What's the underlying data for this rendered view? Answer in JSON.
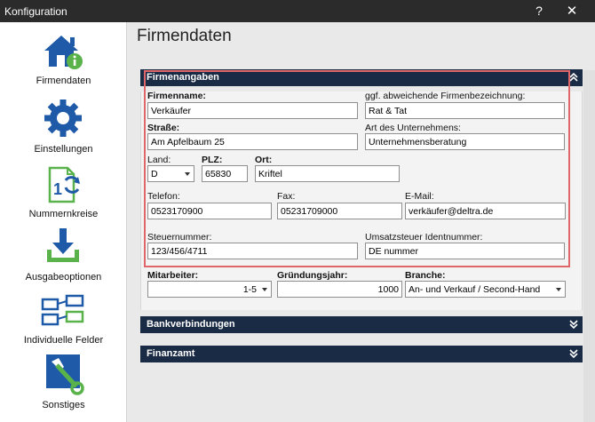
{
  "window": {
    "title": "Konfiguration",
    "help_label": "?",
    "close_label": "✕"
  },
  "sidebar": {
    "items": [
      {
        "label": "Firmendaten",
        "icon": "home-info-icon"
      },
      {
        "label": "Einstellungen",
        "icon": "gear-icon"
      },
      {
        "label": "Nummernkreise",
        "icon": "numbering-icon"
      },
      {
        "label": "Ausgabeoptionen",
        "icon": "download-icon"
      },
      {
        "label": "Individuelle Felder",
        "icon": "custom-fields-icon"
      },
      {
        "label": "Sonstiges",
        "icon": "wrench-icon"
      }
    ]
  },
  "main": {
    "title": "Firmendaten",
    "panels": {
      "firmenangaben": "Firmenangaben",
      "bankverbindungen": "Bankverbindungen",
      "finanzamt": "Finanzamt"
    },
    "fields": {
      "firmenname": {
        "label": "Firmenname:",
        "value": "Verkäufer"
      },
      "abweichend": {
        "label": "ggf. abweichende Firmenbezeichnung:",
        "value": "Rat & Tat"
      },
      "strasse": {
        "label": "Straße:",
        "value": "Am Apfelbaum 25"
      },
      "art": {
        "label": "Art des Unternehmens:",
        "value": "Unternehmensberatung"
      },
      "land": {
        "label": "Land:",
        "value": "D"
      },
      "plz": {
        "label": "PLZ:",
        "value": "65830"
      },
      "ort": {
        "label": "Ort:",
        "value": "Kriftel"
      },
      "telefon": {
        "label": "Telefon:",
        "value": "0523170900"
      },
      "fax": {
        "label": "Fax:",
        "value": "05231709000"
      },
      "email": {
        "label": "E-Mail:",
        "value": "verkäufer@deltra.de"
      },
      "steuernummer": {
        "label": "Steuernummer:",
        "value": "123/456/4711"
      },
      "ustid": {
        "label": "Umsatzsteuer Identnummer:",
        "value": "DE nummer"
      },
      "mitarbeiter": {
        "label": "Mitarbeiter:",
        "value": "1-5"
      },
      "gruendungsjahr": {
        "label": "Gründungsjahr:",
        "value": "1000"
      },
      "branche": {
        "label": "Branche:",
        "value": "An- und Verkauf / Second-Hand"
      }
    }
  },
  "colors": {
    "titlebar": "#2b2b2b",
    "panel_header": "#1a2b45",
    "icon_blue": "#1f5aa8",
    "icon_green": "#59b24a",
    "highlight": "#e0666a"
  }
}
